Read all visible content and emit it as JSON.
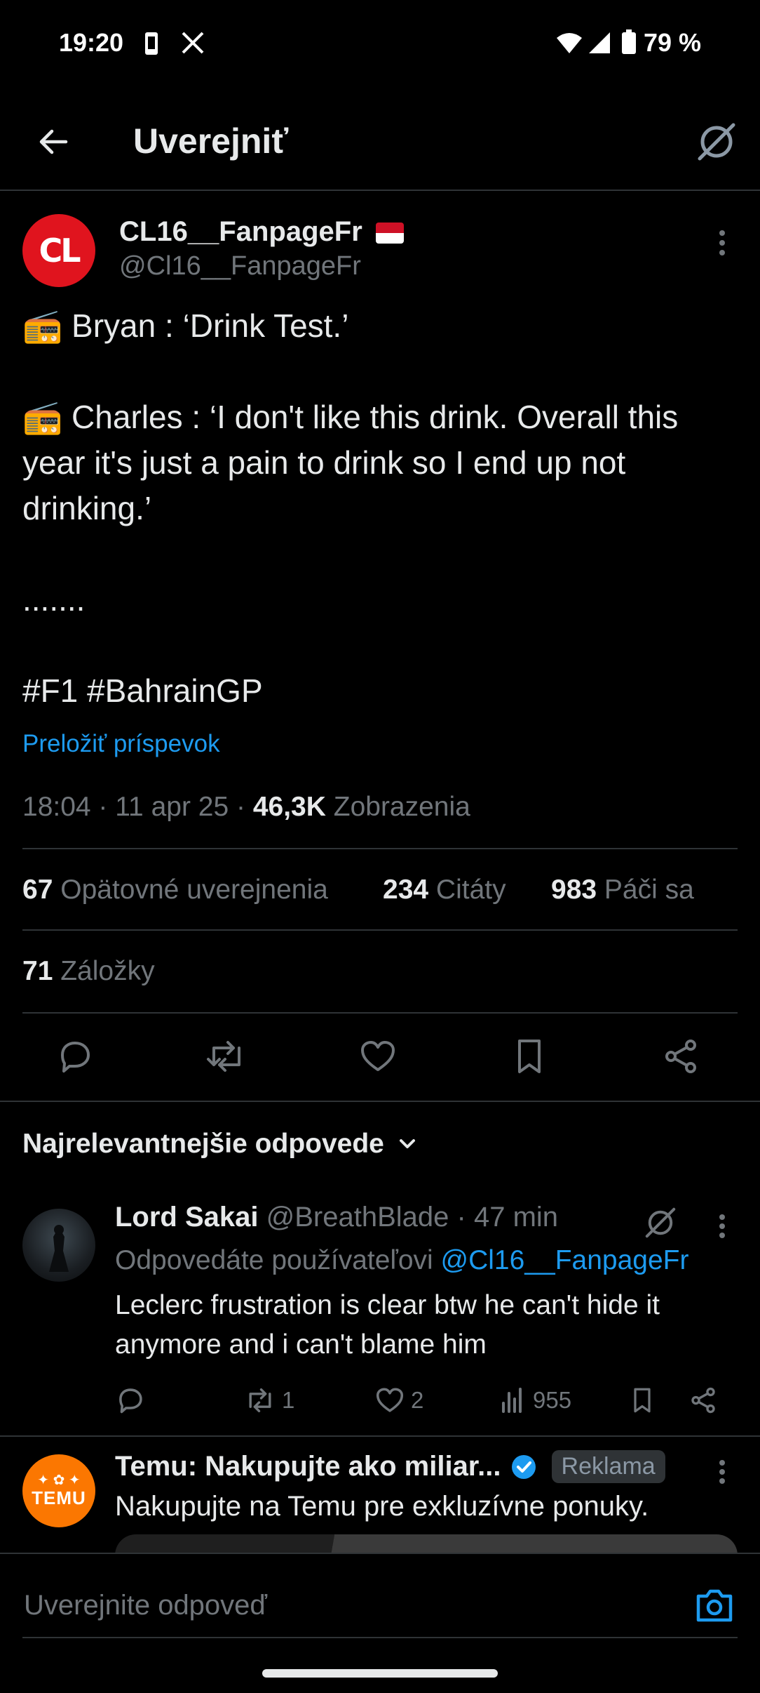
{
  "status_bar": {
    "time": "19:20",
    "battery": "79 %"
  },
  "header": {
    "title": "Uverejniť"
  },
  "post": {
    "display_name": "CL16__FanpageFr",
    "flag": "🇲🇨",
    "handle": "@Cl16__FanpageFr",
    "avatar_text": "CL",
    "lines": [
      "📻 Bryan : ‘Drink Test.’",
      "📻 Charles : ‘I don't like this drink. Overall this year it's just a pain to drink so I end up not drinking.’",
      "......."
    ],
    "hashtags": "#F1 #BahrainGP",
    "translate": "Preložiť príspevok",
    "time": "18:04 · 11 apr 25 · ",
    "views_count": "46,3K",
    "views_label": " Zobrazenia",
    "stats": {
      "reposts_count": "67",
      "reposts_label": "Opätovné uverejnenia",
      "quotes_count": "234",
      "quotes_label": "Citáty",
      "likes_count": "983",
      "likes_label": "Páči sa",
      "bookmarks_count": "71",
      "bookmarks_label": "Záložky"
    },
    "action_icons": [
      "reply-icon",
      "retweet-icon",
      "like-icon",
      "bookmark-icon",
      "share-icon"
    ]
  },
  "replies_sort": {
    "label": "Najrelevantnejšie odpovede"
  },
  "reply": {
    "name": "Lord Sakai",
    "handle": "@BreathBlade",
    "time": "· 47 min",
    "replying_prefix": "Odpovedáte používateľovi ",
    "replying_to": "@Cl16__FanpageFr",
    "text": "Leclerc frustration is clear btw he can't hide it anymore and i can't blame him",
    "retweets": "1",
    "likes": "2",
    "views": "955"
  },
  "ad": {
    "name": "Temu: Nakupujte ako miliar...",
    "badge": "Reklama",
    "text": "Nakupujte na Temu pre exkluzívne ponuky.",
    "avatar_text": "TEMU"
  },
  "composer": {
    "placeholder": "Uverejnite odpoveď"
  },
  "colors": {
    "accent": "#1d9bf0",
    "background": "#000000",
    "divider": "#2f3336",
    "temu": "#fb7701",
    "avatar_red": "#e0141e"
  }
}
